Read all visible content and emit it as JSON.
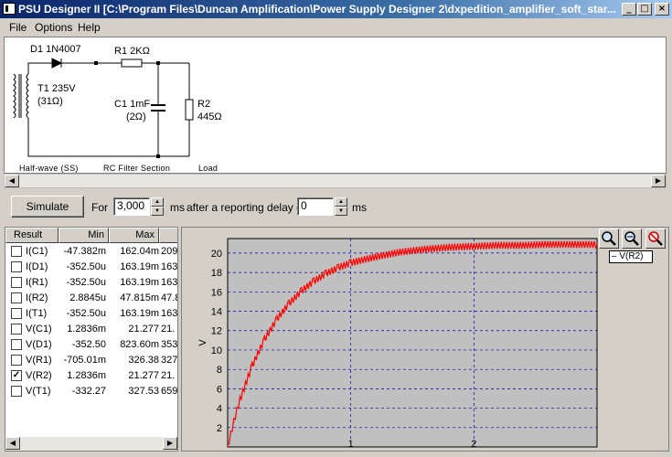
{
  "window": {
    "title": "PSU Designer II  [C:\\Program Files\\Duncan Amplification\\Power Supply Designer 2\\dxpedition_amplifier_soft_star...",
    "buttons": {
      "minimize": "_",
      "maximize": "□",
      "close": "×"
    }
  },
  "menu": [
    "File",
    "Options",
    "Help"
  ],
  "schematic": {
    "d1": "D1 1N4007",
    "t1_line1": "T1 235V",
    "t1_line2": "(31Ω)",
    "r1": "R1 2KΩ",
    "c1_line1": "C1 1mF",
    "c1_line2": "(2Ω)",
    "r2_line1": "R2",
    "r2_line2": "445Ω",
    "section_halfwave": "Half-wave (SS)",
    "section_rc": "RC Filter Section",
    "section_load": "Load"
  },
  "controls": {
    "simulate": "Simulate",
    "for_label": "For",
    "duration": "3,000",
    "ms1": "ms",
    "after_label": "after a reporting delay of",
    "delay": "0",
    "ms2": "ms"
  },
  "results": {
    "headers": [
      "Result",
      "Min",
      "Max",
      ""
    ],
    "rows": [
      {
        "name": "I(C1)",
        "min": "-47.382m",
        "max": "162.04m",
        "extra": "209.",
        "checked": false
      },
      {
        "name": "I(D1)",
        "min": "-352.50u",
        "max": "163.19m",
        "extra": "163.",
        "checked": false
      },
      {
        "name": "I(R1)",
        "min": "-352.50u",
        "max": "163.19m",
        "extra": "163.",
        "checked": false
      },
      {
        "name": "I(R2)",
        "min": "2.8845u",
        "max": "47.815m",
        "extra": "47.8",
        "checked": false
      },
      {
        "name": "I(T1)",
        "min": "-352.50u",
        "max": "163.19m",
        "extra": "163.",
        "checked": false
      },
      {
        "name": "V(C1)",
        "min": "1.2836m",
        "max": "21.277",
        "extra": "21.",
        "checked": false
      },
      {
        "name": "V(D1)",
        "min": "-352.50",
        "max": "823.60m",
        "extra": "353",
        "checked": false
      },
      {
        "name": "V(R1)",
        "min": "-705.01m",
        "max": "326.38",
        "extra": "327",
        "checked": false
      },
      {
        "name": "V(R2)",
        "min": "1.2836m",
        "max": "21.277",
        "extra": "21.",
        "checked": true
      },
      {
        "name": "V(T1)",
        "min": "-332.27",
        "max": "327.53",
        "extra": "659",
        "checked": false
      }
    ]
  },
  "zoom_icons": [
    "zoom-in-icon",
    "zoom-out-icon",
    "zoom-reset-icon"
  ],
  "chart_data": {
    "type": "line",
    "title": "",
    "xlabel": "",
    "ylabel": "V",
    "xlim": [
      0,
      3
    ],
    "ylim": [
      0,
      21.5
    ],
    "x_ticks": [
      "1",
      "2"
    ],
    "y_ticks": [
      "2",
      "4",
      "6",
      "8",
      "10",
      "12",
      "14",
      "16",
      "18",
      "20"
    ],
    "grid": true,
    "legend_position": "top-right",
    "series": [
      {
        "name": "V(R2)",
        "color": "#ff0000",
        "x": [
          0.0,
          0.05,
          0.1,
          0.2,
          0.3,
          0.4,
          0.5,
          0.6,
          0.7,
          0.8,
          0.9,
          1.0,
          1.2,
          1.4,
          1.6,
          1.8,
          2.0,
          2.2,
          2.4,
          2.6,
          2.8,
          3.0
        ],
        "y": [
          0.0,
          2.6,
          4.9,
          8.4,
          11.1,
          13.2,
          14.8,
          16.1,
          17.1,
          17.9,
          18.5,
          19.0,
          19.6,
          20.1,
          20.4,
          20.6,
          20.7,
          20.8,
          20.8,
          20.9,
          20.9,
          20.9
        ]
      }
    ]
  },
  "colors": {
    "background": "#d4d0c8",
    "plot_bg": "#c0c0c0",
    "grid": "#0000a0",
    "trace": "#ff0000"
  }
}
